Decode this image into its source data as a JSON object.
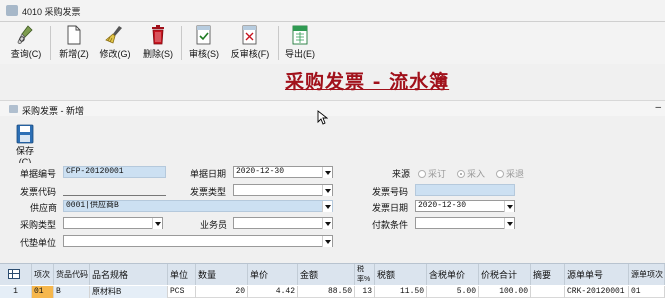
{
  "window": {
    "title": "4010 采购发票"
  },
  "toolbar": {
    "query": "查询(C)",
    "add": "新增(Z)",
    "modify": "修改(G)",
    "delete": "删除(S)",
    "audit": "审核(S)",
    "unaudit": "反审核(F)",
    "export": "导出(E)"
  },
  "banner": "采购发票 - 流水簿",
  "inner": {
    "title": "采购发票 - 新增",
    "save": "保存(C)"
  },
  "form": {
    "doc_no_label": "单据编号",
    "doc_no": "CFP-20120001",
    "doc_date_label": "单据日期",
    "doc_date": "2020-12-30",
    "source_label": "来源",
    "source_options": [
      "采订",
      "采入",
      "采退"
    ],
    "source_selected": "采入",
    "invoice_code_label": "发票代码",
    "invoice_code": "",
    "invoice_type_label": "发票类型",
    "invoice_type": "",
    "invoice_no_label": "发票号码",
    "invoice_no": "",
    "supplier_label": "供应商",
    "supplier": "0001|供应商B",
    "invoice_date_label": "发票日期",
    "invoice_date": "2020-12-30",
    "purchase_type_label": "采购类型",
    "purchase_type": "",
    "salesman_label": "业务员",
    "salesman": "",
    "pay_terms_label": "付款条件",
    "pay_terms": "",
    "advance_unit_label": "代垫单位",
    "advance_unit": ""
  },
  "grid": {
    "headers": {
      "item_no": "项次",
      "product_code": "货品代码",
      "product_name": "品名规格",
      "unit": "单位",
      "qty": "数量",
      "price": "单价",
      "amount": "金额",
      "tax_rate": "税率%",
      "tax": "税额",
      "tax_price": "含税单价",
      "total": "价税合计",
      "summary": "摘要",
      "src_no": "源单单号",
      "src_item": "源单项次"
    },
    "rows": [
      {
        "index": "1",
        "item_no": "01",
        "product_code": "B",
        "product_name": "原材料B",
        "unit": "PCS",
        "qty": "20",
        "price": "4.42",
        "amount": "88.50",
        "tax_rate": "13",
        "tax": "11.50",
        "tax_price": "5.00",
        "total": "100.00",
        "summary": "",
        "src_no": "CRK-20120001",
        "src_item": "01"
      }
    ]
  }
}
